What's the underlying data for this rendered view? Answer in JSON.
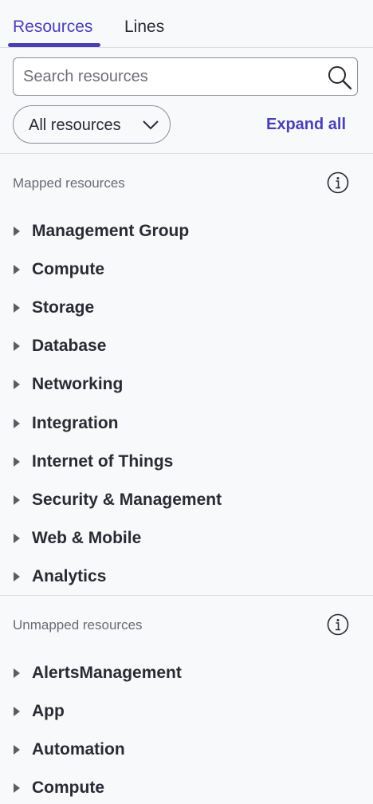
{
  "tabs": [
    {
      "label": "Resources",
      "active": true
    },
    {
      "label": "Lines",
      "active": false
    }
  ],
  "search": {
    "placeholder": "Search resources",
    "value": ""
  },
  "filter": {
    "selected": "All resources"
  },
  "expand_all_label": "Expand all",
  "accent_color": "#4b3fb5",
  "mapped": {
    "title": "Mapped resources",
    "items": [
      {
        "label": "Management Group"
      },
      {
        "label": "Compute"
      },
      {
        "label": "Storage"
      },
      {
        "label": "Database"
      },
      {
        "label": "Networking"
      },
      {
        "label": "Integration"
      },
      {
        "label": "Internet of Things"
      },
      {
        "label": "Security & Management"
      },
      {
        "label": "Web & Mobile"
      },
      {
        "label": "Analytics"
      }
    ]
  },
  "unmapped": {
    "title": "Unmapped resources",
    "items": [
      {
        "label": "AlertsManagement"
      },
      {
        "label": "App"
      },
      {
        "label": "Automation"
      },
      {
        "label": "Compute"
      }
    ]
  }
}
